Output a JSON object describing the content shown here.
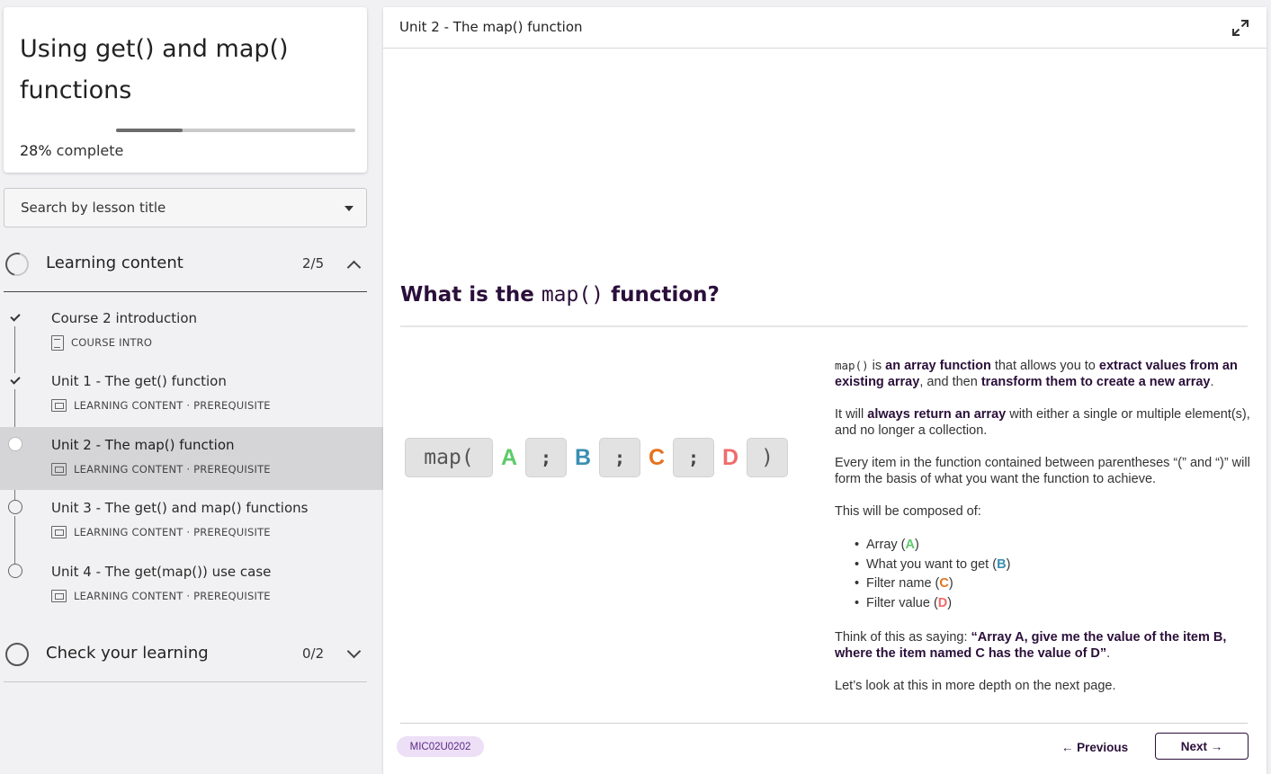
{
  "course": {
    "title": "Using get() and map() functions",
    "progress_fraction": 0.28,
    "progress_percent": "28%",
    "progress_suffix": "complete"
  },
  "search": {
    "placeholder": "Search by lesson title"
  },
  "sections": [
    {
      "label": "Learning content",
      "count": "2/5",
      "expanded": true,
      "lessons": [
        {
          "title": "Course 2 introduction",
          "meta": "COURSE INTRO",
          "icon": "document-icon",
          "state": "done"
        },
        {
          "title": "Unit 1 - The get() function",
          "meta": "LEARNING CONTENT · PREREQUISITE",
          "icon": "screen-icon",
          "state": "done"
        },
        {
          "title": "Unit 2 - The map() function",
          "meta": "LEARNING CONTENT · PREREQUISITE",
          "icon": "screen-icon",
          "state": "current"
        },
        {
          "title": "Unit 3 - The get() and map() functions",
          "meta": "LEARNING CONTENT · PREREQUISITE",
          "icon": "screen-icon",
          "state": "todo"
        },
        {
          "title": "Unit 4 - The get(map()) use case",
          "meta": "LEARNING CONTENT · PREREQUISITE",
          "icon": "screen-icon",
          "state": "todo"
        }
      ]
    },
    {
      "label": "Check your learning",
      "count": "0/2",
      "expanded": false
    }
  ],
  "main": {
    "header_title": "Unit 2 - The map() function",
    "heading": {
      "pre": "What is the ",
      "code": "map()",
      "post": " function?"
    },
    "syntax": {
      "open": "map(",
      "sep": ";",
      "close": ")",
      "letters": [
        "A",
        "B",
        "C",
        "D"
      ],
      "colors": {
        "A": "#5fca6a",
        "B": "#3a8fb3",
        "C": "#e6721d",
        "D": "#f06b6b"
      }
    },
    "desc": {
      "p1_code": "map()",
      "p1_t1": " is ",
      "p1_b1": "an array function",
      "p1_t2": " that allows you to ",
      "p1_b2": "extract values from an existing array",
      "p1_t3": ", and then ",
      "p1_b3": "transform them to create a new array",
      "p1_t4": ".",
      "p2_t1": "It will ",
      "p2_b1": "always return an array",
      "p2_t2": " with either a single or multiple element(s), and no longer a collection.",
      "p3": "Every item in the function contained between parentheses “(” and “)” will form the basis of what you want the function to achieve.",
      "p4": "This will be composed of:",
      "items": [
        {
          "text": "Array (",
          "letter": "A",
          "end": ")"
        },
        {
          "text": "What you want to get (",
          "letter": "B",
          "end": ")"
        },
        {
          "text": "Filter name (",
          "letter": "C",
          "end": ")"
        },
        {
          "text": "Filter value (",
          "letter": "D",
          "end": ")"
        }
      ],
      "p5_t1": "Think of this as saying: ",
      "p5_b1": "“Array A, give me the value of the item B, where the item named C has the value of D”",
      "p5_t2": ".",
      "p6": "Let’s look at this in more depth on the next page."
    },
    "badge": "MIC02U0202",
    "prev_label": "← Previous",
    "next_label": "Next →"
  }
}
